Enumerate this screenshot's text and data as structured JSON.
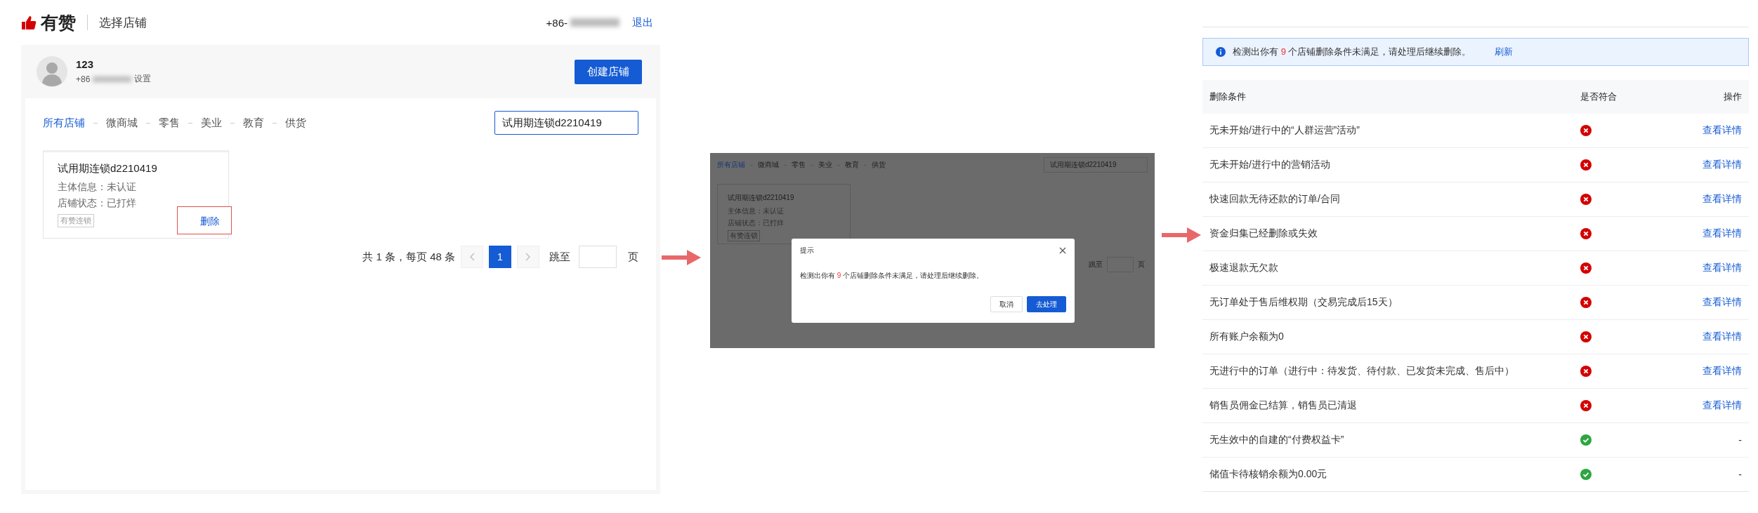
{
  "store_page": {
    "brand": "有赞",
    "title": "选择店铺",
    "phone": "+86-",
    "logout": "退出",
    "account": {
      "name": "123",
      "phone": "+86",
      "settings": "设置"
    },
    "create_button": "创建店铺",
    "tabs": [
      {
        "label": "所有店铺",
        "selected": true
      },
      {
        "label": "微商城",
        "selected": false
      },
      {
        "label": "零售",
        "selected": false
      },
      {
        "label": "美业",
        "selected": false
      },
      {
        "label": "教育",
        "selected": false
      },
      {
        "label": "供货",
        "selected": false
      }
    ],
    "search": {
      "value": "试用期连锁d2210419"
    },
    "stores": [
      {
        "name": "试用期连锁d2210419",
        "lines": [
          "主体信息：未认证",
          "店铺状态：已打烊"
        ],
        "tag": "有赞连锁",
        "delete": "删除",
        "highlighted": true
      }
    ],
    "pagination": {
      "summary": "共 1 条，每页 48 条",
      "pages": [
        {
          "label": "1",
          "selected": true
        }
      ],
      "jump_label": "跳至",
      "page_unit": "页"
    }
  },
  "dialog_screenshot": {
    "tabs": [
      {
        "label": "所有店铺",
        "selected": true
      },
      {
        "label": "微商城",
        "selected": false
      },
      {
        "label": "零售",
        "selected": false
      },
      {
        "label": "美业",
        "selected": false
      },
      {
        "label": "教育",
        "selected": false
      },
      {
        "label": "供货",
        "selected": false
      }
    ],
    "search": {
      "value": "试用期连锁d2210419"
    },
    "store": {
      "name": "试用期连锁d2210419",
      "lines": [
        "主体信息：未认证",
        "店铺状态：已打烊"
      ],
      "tag": "有赞连锁"
    },
    "jump_label": "跳至",
    "page_unit": "页",
    "dialog": {
      "title": "提示",
      "prefix": "检测出你有 ",
      "count": "9",
      "suffix": " 个店铺删除条件未满足，请处理后继续删除。",
      "buttons": [
        {
          "label": "取消",
          "kind": "secondary"
        },
        {
          "label": "去处理",
          "kind": "primary"
        }
      ]
    }
  },
  "conditions": {
    "alert": {
      "prefix": "检测出你有 ",
      "count": "9",
      "suffix": " 个店铺删除条件未满足，请处理后继续删除。",
      "action": "刷新"
    },
    "columns": [
      "删除条件",
      "是否符合",
      "操作"
    ],
    "rows": [
      {
        "condition": "无未开始/进行中的“人群运营”活动”",
        "met": false,
        "action": "查看详情"
      },
      {
        "condition": "无未开始/进行中的营销活动",
        "met": false,
        "action": "查看详情"
      },
      {
        "condition": "快速回款无待还款的订单/合同",
        "met": false,
        "action": "查看详情"
      },
      {
        "condition": "资金归集已经删除或失效",
        "met": false,
        "action": "查看详情"
      },
      {
        "condition": "极速退款无欠款",
        "met": false,
        "action": "查看详情"
      },
      {
        "condition": "无订单处于售后维权期（交易完成后15天）",
        "met": false,
        "action": "查看详情"
      },
      {
        "condition": "所有账户余额为0",
        "met": false,
        "action": "查看详情"
      },
      {
        "condition": "无进行中的订单（进行中：待发货、待付款、已发货未完成、售后中）",
        "met": false,
        "action": "查看详情"
      },
      {
        "condition": "销售员佣金已结算，销售员已清退",
        "met": false,
        "action": "查看详情"
      },
      {
        "condition": "无生效中的自建的“付费权益卡”",
        "met": true,
        "action": "-"
      },
      {
        "condition": "储值卡待核销余额为0.00元",
        "met": true,
        "action": "-"
      }
    ]
  }
}
